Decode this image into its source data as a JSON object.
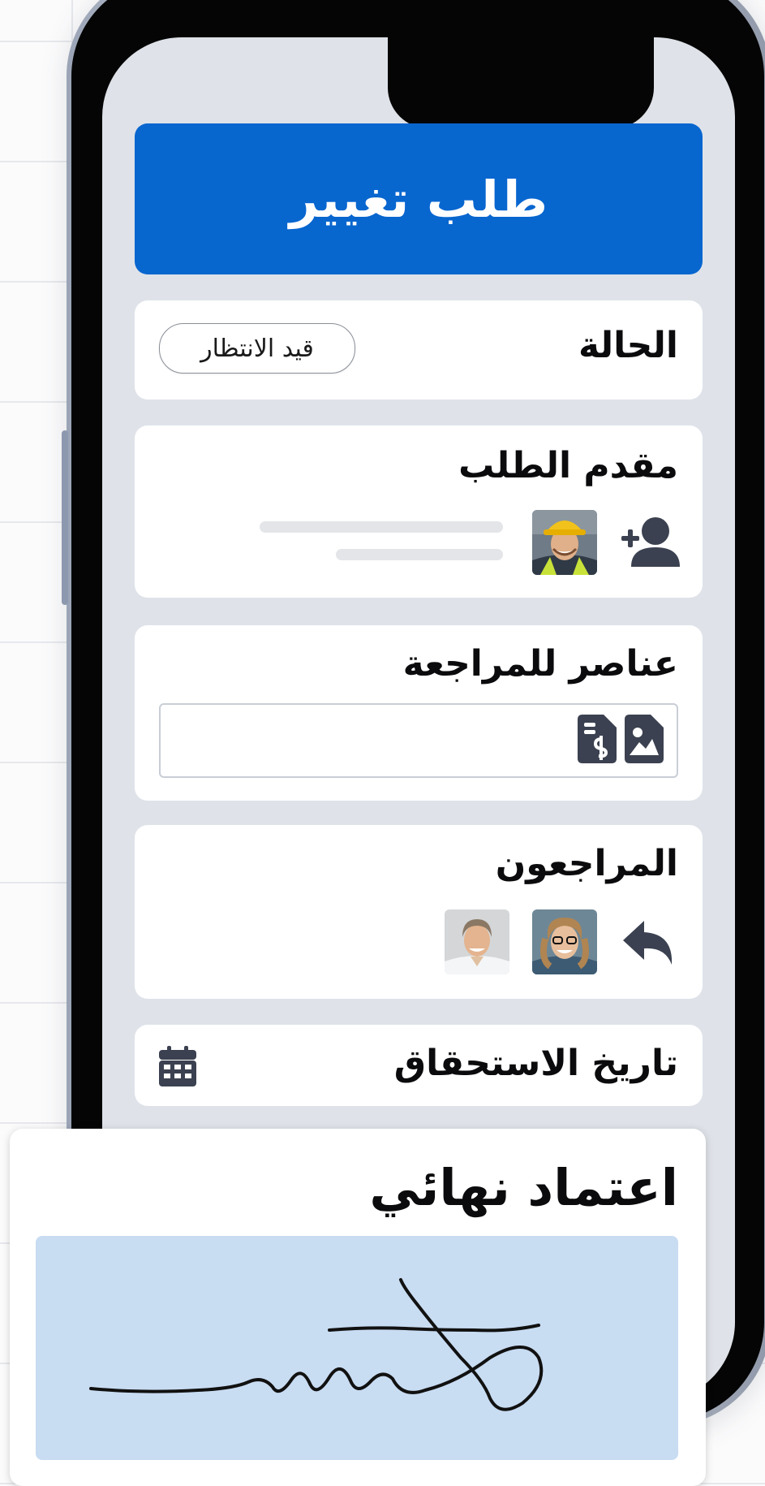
{
  "header": {
    "title": "طلب تغيير"
  },
  "status": {
    "label": "الحالة",
    "value": "قيد الانتظار"
  },
  "requester": {
    "label": "مقدم الطلب",
    "icons": [
      "add-user-icon"
    ]
  },
  "review_items": {
    "label": "عناصر للمراجعة",
    "icons": [
      "file-image-icon",
      "file-invoice-icon"
    ]
  },
  "reviewers": {
    "label": "المراجعون",
    "icons": [
      "reply-icon"
    ],
    "count": 2
  },
  "due_date": {
    "label": "تاريخ الاستحقاق",
    "icons": [
      "calendar-icon"
    ]
  },
  "final_approval": {
    "label": "اعتماد نهائي"
  },
  "colors": {
    "header_blue": "#0866cf",
    "screen_bg": "#dfe3e9",
    "signature_bg": "#c8dcf2",
    "icon_dark": "#3b4150"
  }
}
